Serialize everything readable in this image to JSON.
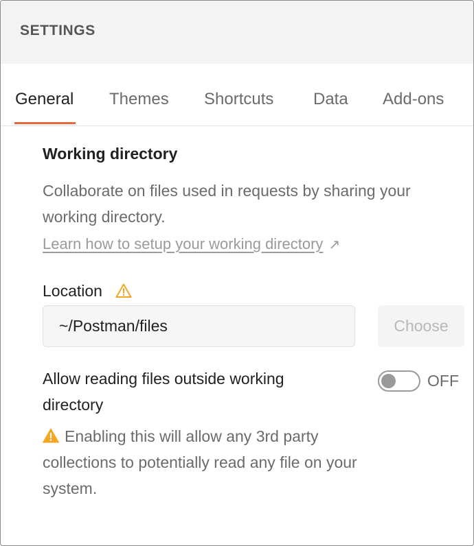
{
  "header": {
    "title": "SETTINGS"
  },
  "tabs": [
    {
      "label": "General",
      "active": true
    },
    {
      "label": "Themes",
      "active": false
    },
    {
      "label": "Shortcuts",
      "active": false
    },
    {
      "label": "Data",
      "active": false
    },
    {
      "label": "Add-ons",
      "active": false
    }
  ],
  "working_directory": {
    "title": "Working directory",
    "description": "Collaborate on files used in requests by sharing your working directory.",
    "learn_link": "Learn how to setup your working directory",
    "location_label": "Location",
    "location_value": "~/Postman/files",
    "choose_label": "Choose",
    "allow_label": "Allow reading files outside working directory",
    "toggle_state": "OFF",
    "warning_text": "Enabling this will allow any 3rd party collections to potentially read any file on your system."
  },
  "colors": {
    "accent": "#e4683a",
    "warning": "#f5a623"
  },
  "icons": {
    "external_link": "arrow-up-right-icon",
    "location_warning": "warning-outline-icon",
    "notice_warning": "warning-filled-icon"
  }
}
